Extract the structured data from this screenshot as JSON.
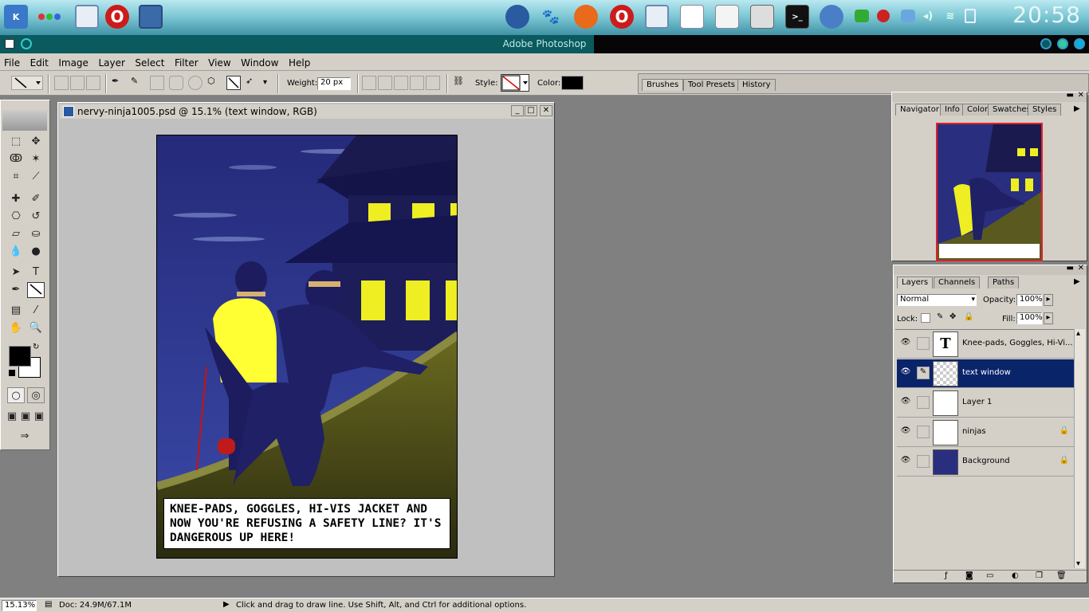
{
  "taskbar": {
    "clock": "20:58",
    "launchers": [
      "kde-menu-icon",
      "dots-icon",
      "file-manager-icon",
      "opera-icon",
      "photoshop-icon"
    ],
    "apps": [
      "photoshop-icon",
      "gimp-icon",
      "firefox-icon",
      "opera-icon",
      "file-manager-icon",
      "writer-icon",
      "editor-icon",
      "calculator-icon",
      "terminal-icon",
      "browser-icon"
    ],
    "tray": [
      "chat-icon",
      "opera-tray-icon",
      "network-icon",
      "volume-icon",
      "wifi-icon",
      "battery-icon"
    ]
  },
  "window": {
    "title": "Adobe Photoshop"
  },
  "menu": [
    "File",
    "Edit",
    "Image",
    "Layer",
    "Select",
    "Filter",
    "View",
    "Window",
    "Help"
  ],
  "options": {
    "weight_label": "Weight:",
    "weight_value": "20 px",
    "style_label": "Style:",
    "color_label": "Color:",
    "color_value": "#000000"
  },
  "well_tabs": [
    "Brushes",
    "Tool Presets",
    "History"
  ],
  "document": {
    "title": "nervy-ninja1005.psd @ 15.1% (text window, RGB)",
    "caption": "KNEE-PADS, GOGGLES, HI-VIS JACKET AND NOW YOU'RE REFUSING A SAFETY LINE?  IT'S DANGEROUS UP HERE!"
  },
  "navigator": {
    "tabs": [
      "Navigator",
      "Info",
      "Color",
      "Swatches",
      "Styles"
    ]
  },
  "layers": {
    "tabs": [
      "Layers",
      "Channels",
      "Paths"
    ],
    "blend_mode": "Normal",
    "opacity_label": "Opacity:",
    "opacity_value": "100%",
    "lock_label": "Lock:",
    "fill_label": "Fill:",
    "fill_value": "100%",
    "items": [
      {
        "name": "Knee-pads, Goggles, Hi-Vi...",
        "selected": false,
        "locked": false
      },
      {
        "name": "text window",
        "selected": true,
        "locked": false
      },
      {
        "name": "Layer 1",
        "selected": false,
        "locked": false
      },
      {
        "name": "ninjas",
        "selected": false,
        "locked": true
      },
      {
        "name": "Background",
        "selected": false,
        "locked": true
      }
    ]
  },
  "status": {
    "zoom": "15.13%",
    "doc": "Doc: 24.9M/67.1M",
    "hint": "Click and drag to draw line.  Use Shift, Alt, and Ctrl for additional options."
  },
  "colors": {
    "foreground": "#000000",
    "background": "#ffffff",
    "selection": "#0a246a"
  }
}
